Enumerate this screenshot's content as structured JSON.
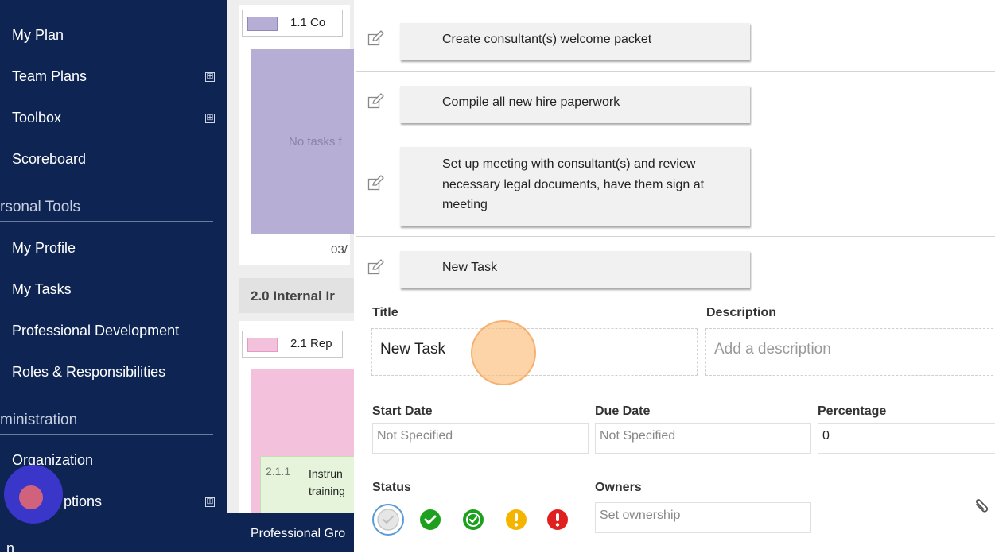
{
  "sidebar": {
    "items": [
      {
        "label": "My Plan"
      },
      {
        "label": "Team Plans",
        "expand": "⊞"
      },
      {
        "label": "Toolbox",
        "expand": "⊞"
      },
      {
        "label": "Scoreboard"
      },
      {
        "label": "My Profile"
      },
      {
        "label": "My Tasks"
      },
      {
        "label": "Professional Development"
      },
      {
        "label": "Roles & Responsibilities"
      },
      {
        "label": "Organization"
      },
      {
        "label": "ptions",
        "expand": "⊞"
      }
    ],
    "sections": [
      "rsonal Tools",
      "ministration"
    ],
    "bottom_partial": "n"
  },
  "middle": {
    "item1_label": "1.1  Co",
    "no_tasks": "No tasks f",
    "date": "03/",
    "section2_title": "2.0 Internal Ir",
    "item2_label": "2.1  Rep",
    "subtask_num": "2.1.1",
    "subtask_text": "Instrun training",
    "footer": "Professional Gro",
    "swatch_colors": [
      "#b6aed4",
      "#f4c1dc"
    ]
  },
  "tasks": [
    {
      "title": "Create consultant(s) welcome packet"
    },
    {
      "title": "Compile all new hire paperwork"
    },
    {
      "title": "Set up meeting with consultant(s) and review necessary legal documents, have them sign at meeting"
    },
    {
      "title": "New Task"
    }
  ],
  "form": {
    "title_label": "Title",
    "title_value": "New Task",
    "description_label": "Description",
    "description_placeholder": "Add a description",
    "start_date_label": "Start Date",
    "start_date_value": "Not Specified",
    "due_date_label": "Due Date",
    "due_date_value": "Not Specified",
    "percentage_label": "Percentage",
    "percentage_value": "0",
    "status_label": "Status",
    "owners_label": "Owners",
    "owners_placeholder": "Set ownership",
    "status_options": [
      "not-started",
      "complete",
      "on-track",
      "warning",
      "critical"
    ],
    "status_colors": [
      "#5b9bd5",
      "#1da01d",
      "#1da01d",
      "#f5b400",
      "#e02020"
    ]
  }
}
